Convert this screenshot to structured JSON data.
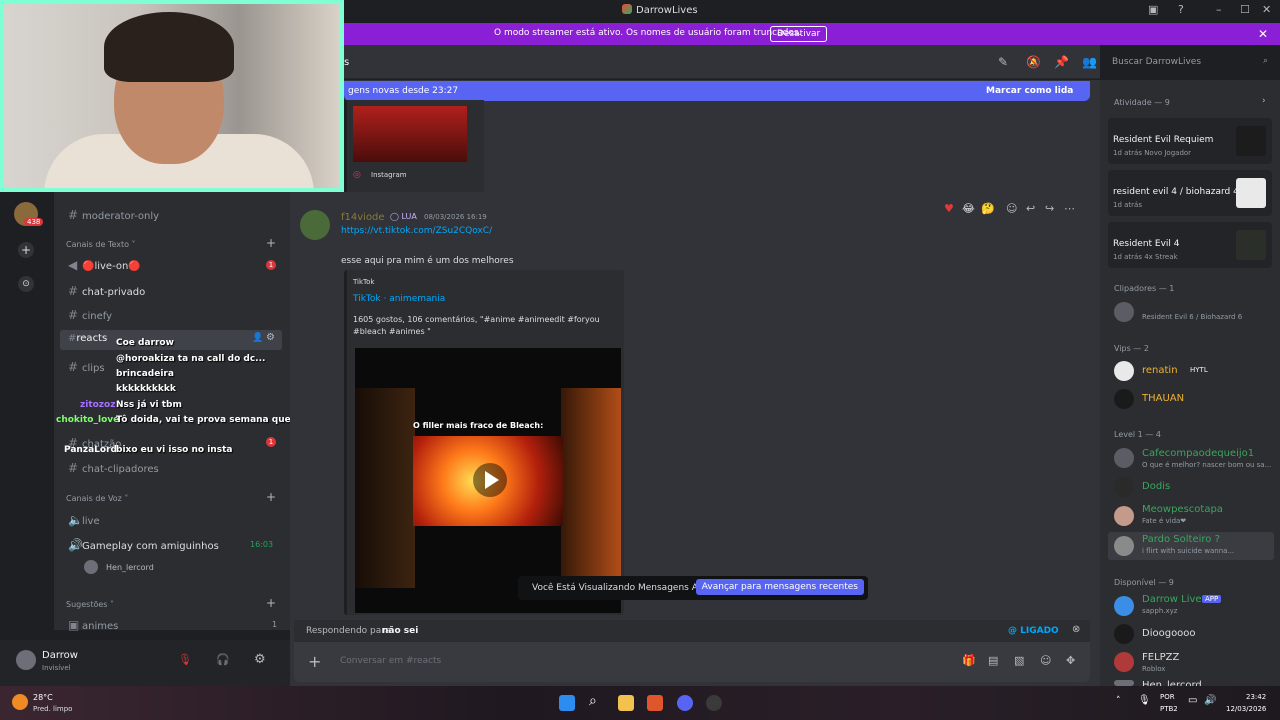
{
  "window": {
    "title": "DarrowLives"
  },
  "streamer_banner": {
    "message": "O modo streamer está ativo. Os nomes de usuário foram truncados.",
    "button": "Desativar"
  },
  "topbar": {
    "channel": "s",
    "search_placeholder": "Buscar DarrowLives"
  },
  "new_messages": {
    "text": "gens novas desde 23:27",
    "mark_read": "Marcar como lida"
  },
  "top_embed": {
    "source": "Instagram"
  },
  "message": {
    "author": "f14viode",
    "tag": "LUA",
    "timestamp": "08/03/2026 16:19",
    "link": "https://vt.tiktok.com/ZSu2CQoxC/",
    "text": "esse aqui pra mim é um dos melhores",
    "embed": {
      "provider": "TikTok",
      "title": "TikTok · animemania",
      "description": "1605 gostos, 106 comentários, \"#anime #animeedit #foryou #bleach #animes \"",
      "video_caption": "O filler mais fraco de Bleach:"
    }
  },
  "old_messages": {
    "text": "Você Está Visualizando Mensagens Antigas",
    "jump": "Avançar para mensagens recentes"
  },
  "reply": {
    "prefix": "Respondendo para",
    "target": "não sei",
    "ping": "@ LIGADO"
  },
  "composer": {
    "placeholder": "Conversar em #reacts"
  },
  "channels": {
    "moderator": "moderator-only",
    "text_category": "Canais de Texto",
    "live_on": "🔴live-on🔴",
    "live_on_badge": "1",
    "chat_privado": "chat-privado",
    "cinefy": "cinefy",
    "reacts": "reacts",
    "clips": "clips",
    "chatzao": "chatzão",
    "chatzao_badge": "1",
    "chat_clipadores": "chat-clipadores",
    "voice_category": "Canais de Voz",
    "live_voice": "live",
    "gameplay": "Gameplay com amiguinhos",
    "gameplay_time": "16:03",
    "voice_user": "Hen_lercord",
    "suggestions_category": "Sugestões",
    "animes": "animes",
    "animes_count": "1",
    "server_badge": "438"
  },
  "user": {
    "name": "Darrow",
    "status": "Invisível"
  },
  "twitch_chat": [
    {
      "user": "",
      "text": "Coe darrow"
    },
    {
      "user": "",
      "text": "@horoakiza ta na call do dc..."
    },
    {
      "user": "",
      "text": "brincadeira"
    },
    {
      "user": "",
      "text": "kkkkkkkkkk"
    },
    {
      "user": "zitozoz",
      "text": "Nss já vi tbm"
    },
    {
      "user": "chokito_love",
      "text": "Tô doida, vai te prova semana que vem"
    },
    {
      "user": "PanzaLord",
      "text": "bixo eu vi isso no insta"
    }
  ],
  "members": {
    "activity_header": "Atividade — 9",
    "activities": [
      {
        "game": "Resident Evil Requiem",
        "meta": "1d atrás  Novo Jogador"
      },
      {
        "game": "resident evil 4 / biohazard 4",
        "meta": "1d atrás"
      },
      {
        "game": "Resident Evil 4",
        "meta": "1d atrás  4x Streak"
      }
    ],
    "clippers_header": "Clipadores — 1",
    "clipper_sub": "Resident Evil 6 / Biohazard 6",
    "vips_header": "Vips — 2",
    "vips": [
      {
        "name": "renatin",
        "tag": "HYTL"
      },
      {
        "name": "THAUAN"
      }
    ],
    "level_header": "Level 1 — 4",
    "level": [
      {
        "name": "Cafecompaodequeijo1",
        "sub": "O que é melhor? nascer bom ou sa..."
      },
      {
        "name": "Dodis",
        "sub": ""
      },
      {
        "name": "Meowpescotapa",
        "sub": "Fate é vida❤"
      },
      {
        "name": "Pardo Solteiro ?",
        "sub": "i flirt with suicide wanna..."
      }
    ],
    "available_header": "Disponível — 9",
    "available": [
      {
        "name": "Darrow Live",
        "tag": "APP",
        "sub": "sapph.xyz"
      },
      {
        "name": "Dioogoooo",
        "sub": ""
      },
      {
        "name": "FELPZZ",
        "sub": "Roblox"
      },
      {
        "name": "Hen_lercord",
        "sub": ""
      }
    ]
  },
  "taskbar": {
    "weather_temp": "28°C",
    "weather_desc": "Pred. limpo",
    "lang1": "POR",
    "lang2": "PTB2",
    "time": "23:42",
    "date": "12/03/2026"
  }
}
